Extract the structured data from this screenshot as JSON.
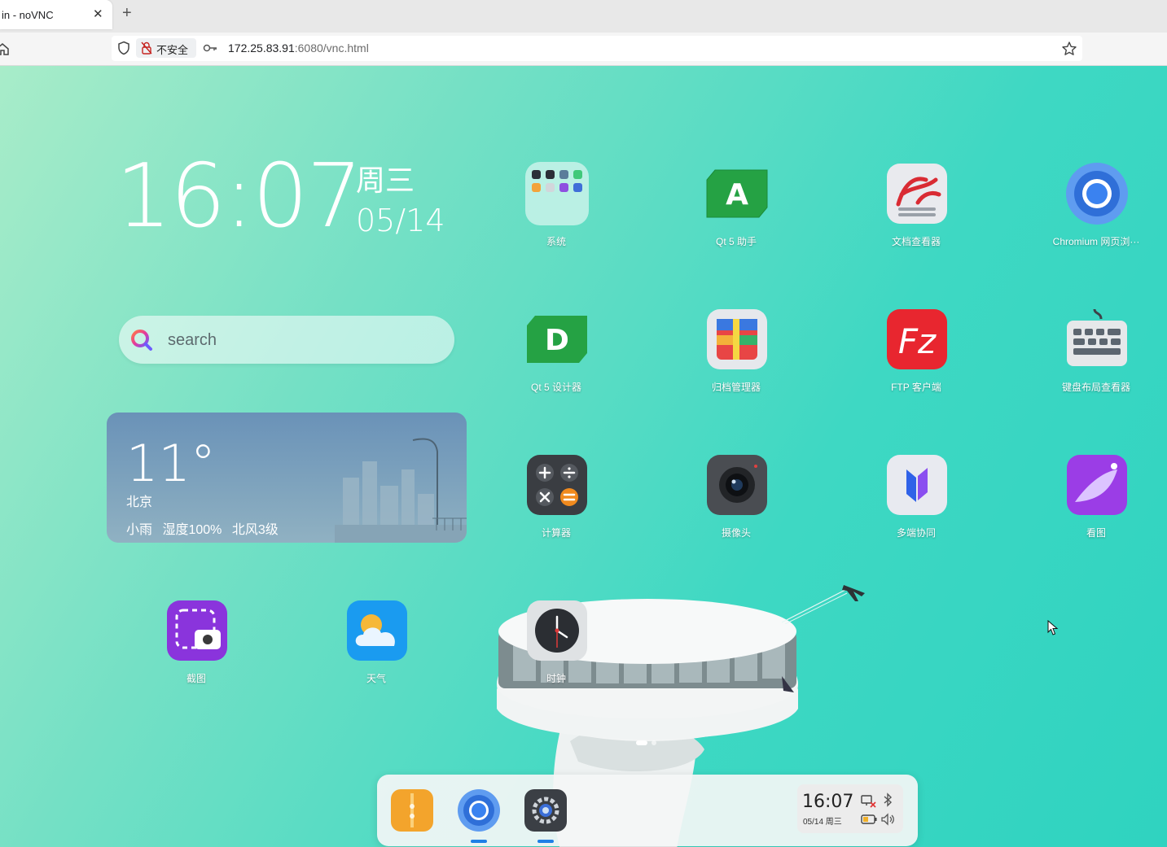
{
  "browser": {
    "tab_title": "in - noVNC",
    "tab_close": "✕",
    "new_tab": "+",
    "security_label": "不安全",
    "url_host": "172.25.83.91",
    "url_path": ":6080/vnc.html"
  },
  "desktop": {
    "clock": {
      "time": "16:07",
      "weekday": "周三",
      "date": "05/14"
    },
    "search": {
      "placeholder": "search"
    },
    "weather": {
      "temperature": "11°",
      "city": "北京",
      "details": "小雨 湿度100% 北风3级"
    },
    "apps": [
      {
        "label": "系统",
        "icon": "system-folder-icon"
      },
      {
        "label": "Qt 5 助手",
        "icon": "qt-assistant-icon"
      },
      {
        "label": "文档查看器",
        "icon": "document-viewer-icon"
      },
      {
        "label": "Chromium 网页浏···",
        "icon": "chromium-icon"
      },
      {
        "label": "Qt 5 设计器",
        "icon": "qt-designer-icon"
      },
      {
        "label": "归档管理器",
        "icon": "archive-manager-icon"
      },
      {
        "label": "FTP 客户端",
        "icon": "ftp-client-icon"
      },
      {
        "label": "键盘布局查看器",
        "icon": "keyboard-layout-icon"
      },
      {
        "label": "计算器",
        "icon": "calculator-icon"
      },
      {
        "label": "摄像头",
        "icon": "camera-icon"
      },
      {
        "label": "多端协同",
        "icon": "multi-device-icon"
      },
      {
        "label": "看图",
        "icon": "image-viewer-icon"
      },
      {
        "label": "截图",
        "icon": "screenshot-icon"
      },
      {
        "label": "天气",
        "icon": "weather-icon"
      },
      {
        "label": "时钟",
        "icon": "clock-icon"
      }
    ],
    "dock": {
      "apps": [
        "file-manager-icon",
        "chromium-icon",
        "settings-icon"
      ],
      "running": [
        false,
        true,
        true
      ],
      "tray": {
        "time": "16:07",
        "date": "05/14 周三"
      }
    }
  },
  "colors": {
    "desktop_start": "#a8ecc9",
    "desktop_end": "#2fd3c0",
    "weather_card": "#7ea3bd",
    "dock_indicator": "#1f7fe6"
  }
}
